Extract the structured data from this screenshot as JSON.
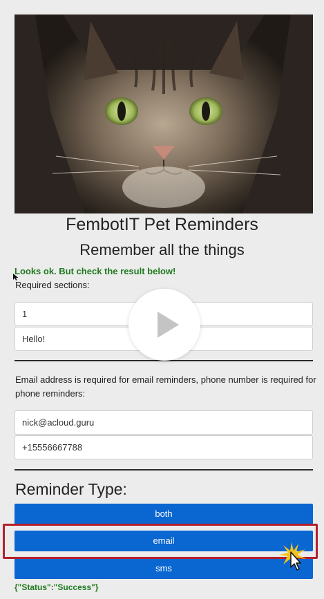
{
  "hero": {
    "image": "tabby-cat-photo"
  },
  "header": {
    "title": "FembotIT Pet Reminders",
    "subtitle": "Remember all the things"
  },
  "validation": {
    "message": "Looks ok. But check the result below!"
  },
  "required": {
    "label": "Required sections:",
    "minutes_value": "1",
    "message_value": "Hello!"
  },
  "contact": {
    "note": "Email address is required for email reminders, phone number is required for phone reminders:",
    "email_value": "nick@acloud.guru",
    "phone_value": "+15556667788"
  },
  "reminder_type": {
    "heading": "Reminder Type:",
    "both_label": "both",
    "email_label": "email",
    "sms_label": "sms"
  },
  "result": {
    "text": "{\"Status\":\"Success\"}"
  },
  "overlay": {
    "play_icon": "play-icon"
  },
  "colors": {
    "button": "#0a66d1",
    "success": "#1f7a1f",
    "highlight": "#b3202b"
  }
}
